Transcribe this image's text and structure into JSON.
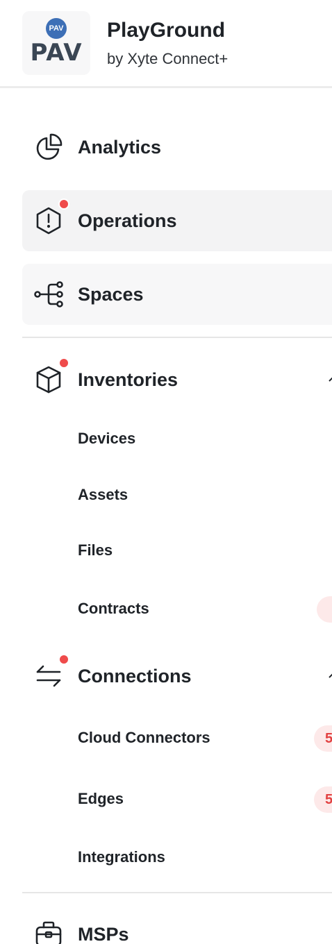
{
  "org": {
    "logo_badge": "PAV",
    "logo_text": "PAV",
    "title": "PlayGround",
    "subtitle": "by Xyte Connect+"
  },
  "nav": {
    "analytics": {
      "label": "Analytics",
      "icon": "pie-chart-icon"
    },
    "operations": {
      "label": "Operations",
      "icon": "alert-hexagon-icon",
      "has_notification": true
    },
    "spaces": {
      "label": "Spaces",
      "icon": "hierarchy-icon"
    },
    "inventories": {
      "label": "Inventories",
      "icon": "cube-icon",
      "has_notification": true,
      "children": [
        {
          "label": "Devices"
        },
        {
          "label": "Assets"
        },
        {
          "label": "Files"
        },
        {
          "label": "Contracts",
          "badge": ""
        }
      ]
    },
    "connections": {
      "label": "Connections",
      "icon": "arrows-exchange-icon",
      "has_notification": true,
      "children": [
        {
          "label": "Cloud Connectors",
          "badge": "5"
        },
        {
          "label": "Edges",
          "badge": "5"
        },
        {
          "label": "Integrations"
        }
      ]
    },
    "msps": {
      "label": "MSPs",
      "icon": "briefcase-icon"
    }
  },
  "colors": {
    "notification": "#ef4b4b",
    "badge_bg": "#fde9e9",
    "badge_text": "#e24141",
    "active_bg": "#f3f3f4"
  }
}
